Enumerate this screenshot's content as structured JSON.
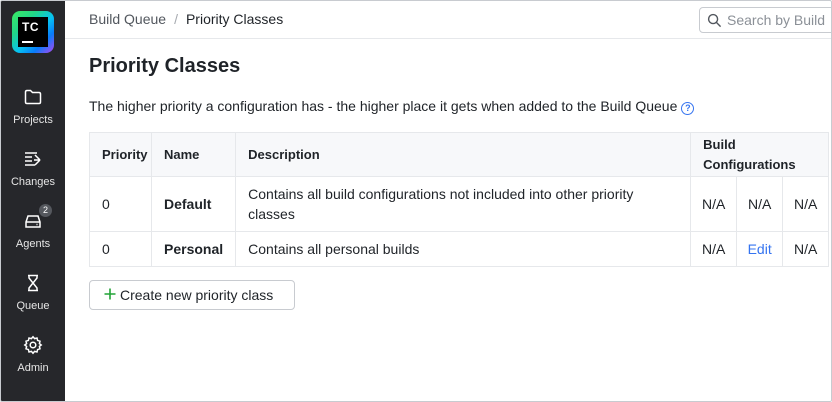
{
  "app": {
    "logo_text": "TC"
  },
  "sidebar": {
    "items": [
      {
        "label": "Projects",
        "icon": "folder-icon"
      },
      {
        "label": "Changes",
        "icon": "changes-icon"
      },
      {
        "label": "Agents",
        "icon": "agents-icon",
        "badge": "2"
      },
      {
        "label": "Queue",
        "icon": "hourglass-icon"
      },
      {
        "label": "Admin",
        "icon": "gear-icon"
      }
    ]
  },
  "header": {
    "breadcrumb": [
      "Build Queue",
      "Priority Classes"
    ],
    "search_placeholder": "Search by Build"
  },
  "main": {
    "title": "Priority Classes",
    "description": "The higher priority a configuration has - the higher place it gets when added to the Build Queue",
    "help_icon": "?",
    "table": {
      "headers": [
        "Priority",
        "Name",
        "Description",
        "Build Configurations"
      ],
      "rows": [
        {
          "priority": "0",
          "name": "Default",
          "description": "Contains all build configurations not included into other priority classes",
          "bc": [
            "N/A",
            "N/A",
            "N/A"
          ]
        },
        {
          "priority": "0",
          "name": "Personal",
          "description": "Contains all personal builds",
          "bc": [
            "N/A",
            "Edit",
            "N/A"
          ]
        }
      ]
    },
    "create_button": "Create new priority class"
  },
  "colors": {
    "sidebar_bg": "#26272b",
    "link": "#3574f0",
    "plus": "#21a336"
  }
}
